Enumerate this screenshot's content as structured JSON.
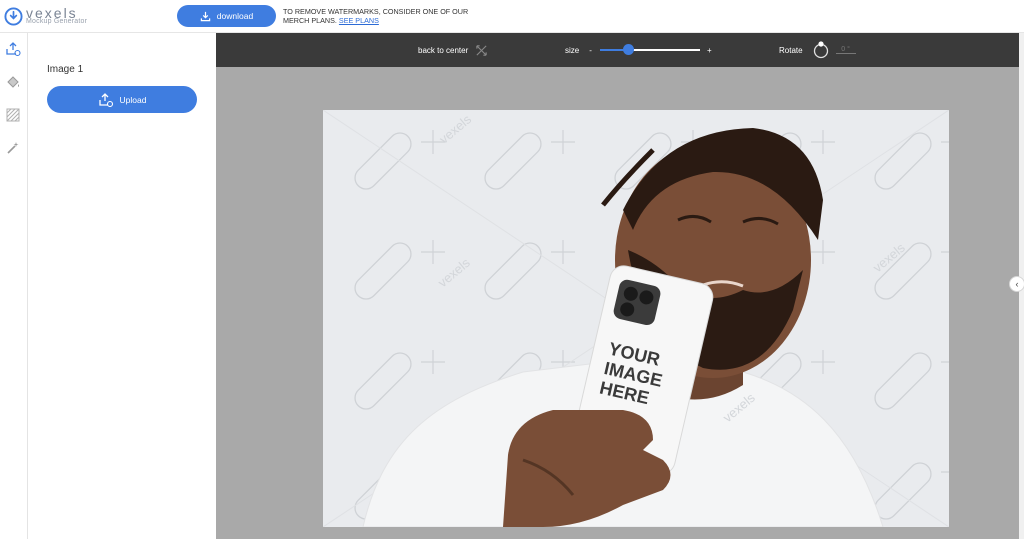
{
  "brand": {
    "name": "vexels",
    "subtitle": "Mockup Generator",
    "accent": "#3f7de0"
  },
  "header": {
    "download_label": "download",
    "notice_text": "TO REMOVE WATERMARKS, CONSIDER ONE OF OUR MERCH PLANS.",
    "notice_link": "SEE PLANS"
  },
  "rail": {
    "items": [
      "upload-icon",
      "paint-bucket-icon",
      "texture-icon",
      "magic-wand-icon"
    ]
  },
  "panel": {
    "title": "Image 1",
    "upload_label": "Upload"
  },
  "toolbar": {
    "back_to_center": "back to center",
    "size_label": "size",
    "size_minus": "-",
    "size_plus": "+",
    "size_level": 0.28,
    "rotate_label": "Rotate",
    "rotate_value": "0 °"
  },
  "mockup": {
    "phone_text_line1": "YOUR",
    "phone_text_line2": "IMAGE",
    "phone_text_line3": "HERE",
    "watermark": "vexels"
  }
}
